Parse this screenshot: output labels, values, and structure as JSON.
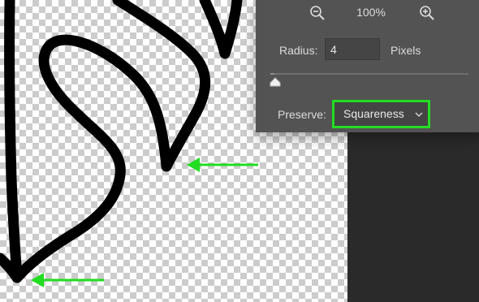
{
  "panel": {
    "zoom_value": "100%",
    "zoom_out_icon": "zoom-out-icon",
    "zoom_in_icon": "zoom-in-icon",
    "radius_label": "Radius:",
    "radius_value": "4",
    "radius_unit": "Pixels",
    "slider_level": 0.02,
    "preserve_label": "Preserve:",
    "preserve_value": "Squareness"
  },
  "colors": {
    "highlight": "#22dd22",
    "arrow": "#22dd22",
    "panel_bg": "#535353",
    "stroke": "#000000"
  }
}
